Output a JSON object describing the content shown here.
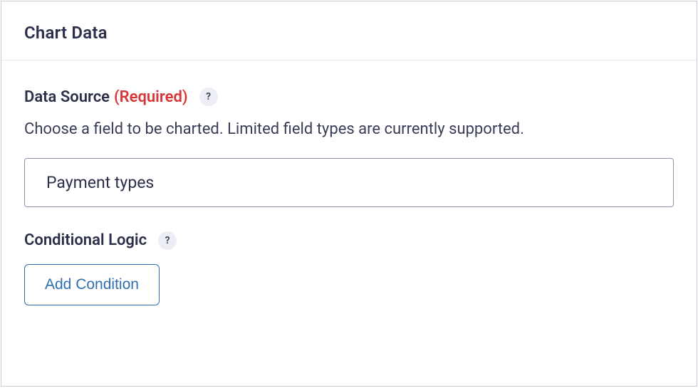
{
  "panel": {
    "title": "Chart Data"
  },
  "dataSource": {
    "label": "Data Source",
    "requiredTag": "(Required)",
    "helpGlyph": "?",
    "helpText": "Choose a field to be charted. Limited field types are currently supported.",
    "selectedValue": "Payment types"
  },
  "conditionalLogic": {
    "label": "Conditional Logic",
    "helpGlyph": "?",
    "addButtonLabel": "Add Condition"
  }
}
